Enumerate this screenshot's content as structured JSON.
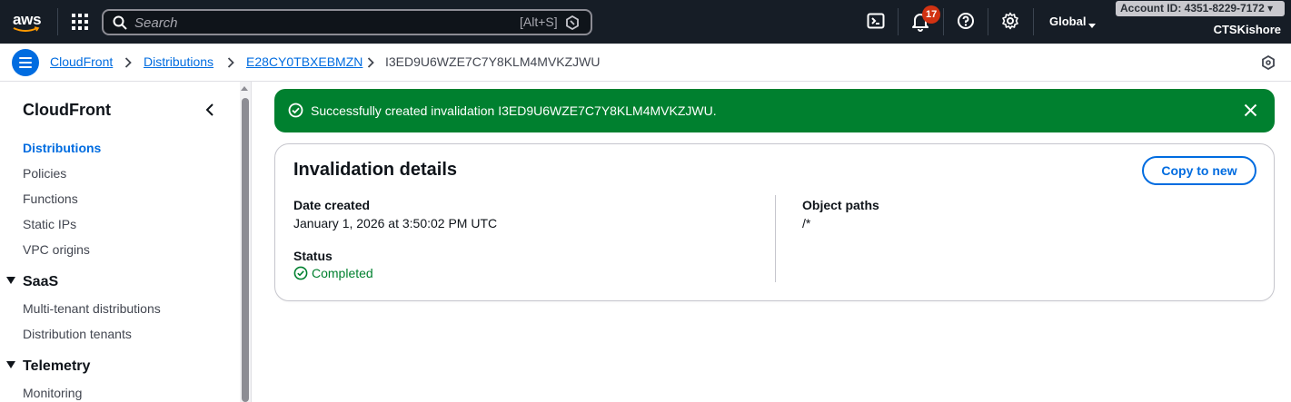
{
  "topnav": {
    "logo_text": "aws",
    "search_placeholder": "Search",
    "search_shortcut": "[Alt+S]",
    "notifications_count": "17",
    "region": "Global",
    "account": "Account ID: 4351-8229-7172 ▾",
    "username": "CTSKishore",
    "icons": [
      "apps-grid-icon",
      "search-icon",
      "amazon-q-icon",
      "cloudshell-icon",
      "bell-icon",
      "help-icon",
      "gear-icon",
      "chevron-down-icon"
    ]
  },
  "breadcrumb": {
    "items": [
      "CloudFront",
      "Distributions",
      "E28CY0TBXEBMZN",
      "I3ED9U6WZE7C7Y8KLM4MVKZJWU"
    ]
  },
  "sidenav": {
    "title": "CloudFront",
    "items": [
      "Distributions",
      "Policies",
      "Functions",
      "Static IPs",
      "VPC origins"
    ],
    "active": "Distributions",
    "sections": [
      {
        "label": "SaaS",
        "items": [
          "Multi-tenant distributions",
          "Distribution tenants"
        ]
      },
      {
        "label": "Telemetry",
        "items": [
          "Monitoring"
        ]
      }
    ]
  },
  "flash": {
    "type": "success",
    "message": "Successfully created invalidation I3ED9U6WZE7C7Y8KLM4MVKZJWU."
  },
  "details": {
    "title": "Invalidation details",
    "copy_button": "Copy to new",
    "date_created_label": "Date created",
    "date_created_value": "January 1, 2026 at 3:50:02 PM UTC",
    "status_label": "Status",
    "status_value": "Completed",
    "object_paths_label": "Object paths",
    "object_paths_value": "/*"
  },
  "colors": {
    "nav_bg": "#161d26",
    "link": "#006ce0",
    "success": "#00802f",
    "badge": "#d13212"
  }
}
